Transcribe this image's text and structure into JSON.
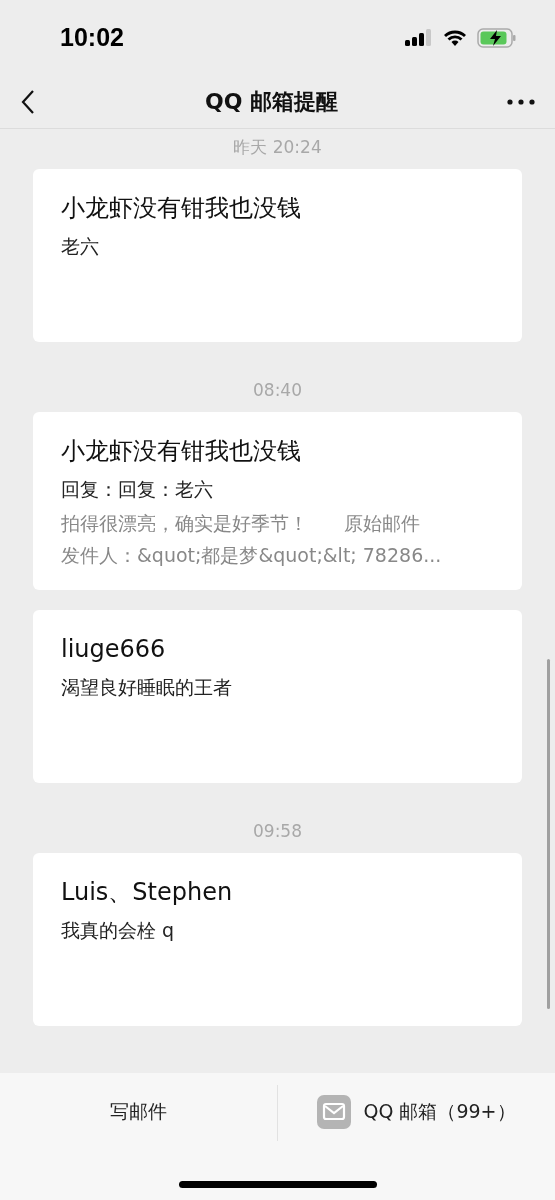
{
  "status_bar": {
    "time": "10:02"
  },
  "nav": {
    "title": "QQ 邮箱提醒"
  },
  "feed": [
    {
      "kind": "time",
      "text": "昨天 20:24"
    },
    {
      "kind": "mail",
      "title": "小龙虾没有钳我也没钱",
      "subtitle": "老六"
    },
    {
      "kind": "time",
      "text": "08:40"
    },
    {
      "kind": "mail",
      "title": "小龙虾没有钳我也没钱",
      "subtitle": "回复：回复：老六",
      "preview": [
        "拍得很漂亮，确实是好季节！      原始邮件",
        "发件人：&quot;都是梦&quot;&lt; 78286..."
      ]
    },
    {
      "kind": "mail",
      "title": "liuge666",
      "subtitle": "渴望良好睡眠的王者"
    },
    {
      "kind": "time",
      "text": "09:58"
    },
    {
      "kind": "mail",
      "title": "Luis、Stephen",
      "subtitle": "我真的会栓 q"
    }
  ],
  "bottom_bar": {
    "compose": "写邮件",
    "mailbox": "QQ 邮箱（99+）"
  }
}
